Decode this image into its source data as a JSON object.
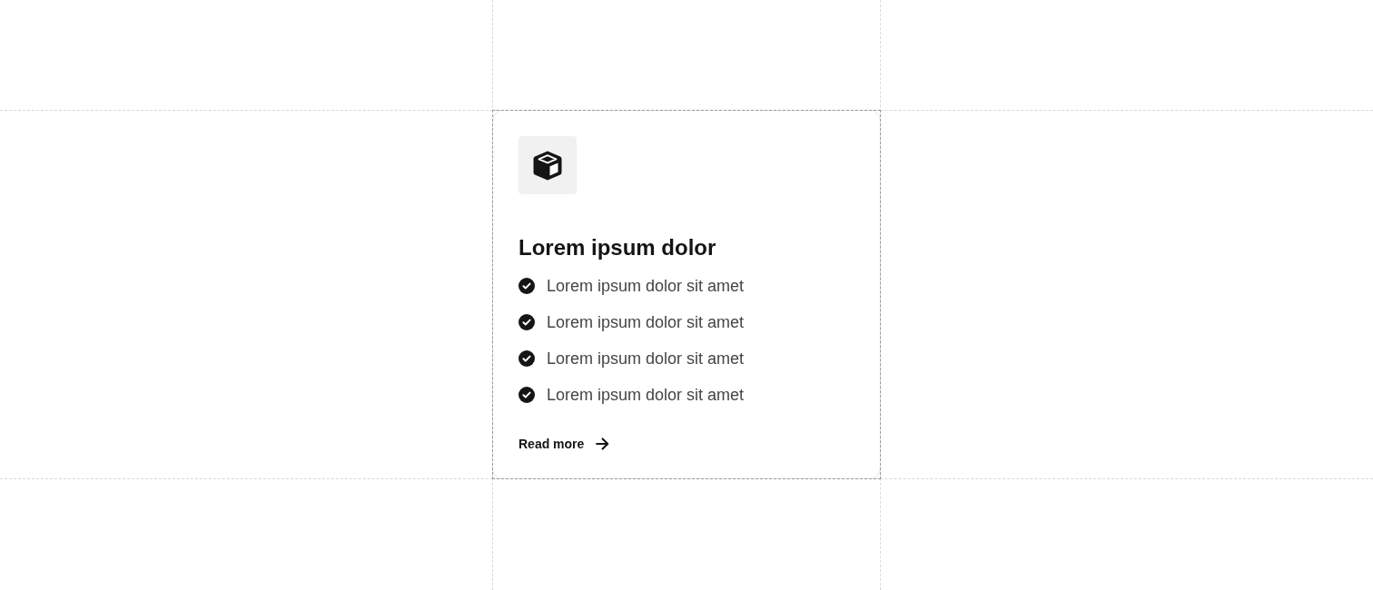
{
  "card": {
    "title": "Lorem ipsum dolor",
    "features": [
      {
        "text": "Lorem ipsum dolor sit amet"
      },
      {
        "text": "Lorem ipsum dolor sit amet"
      },
      {
        "text": "Lorem ipsum dolor sit amet"
      },
      {
        "text": "Lorem ipsum dolor sit amet"
      }
    ],
    "link": {
      "label": "Read more"
    }
  }
}
